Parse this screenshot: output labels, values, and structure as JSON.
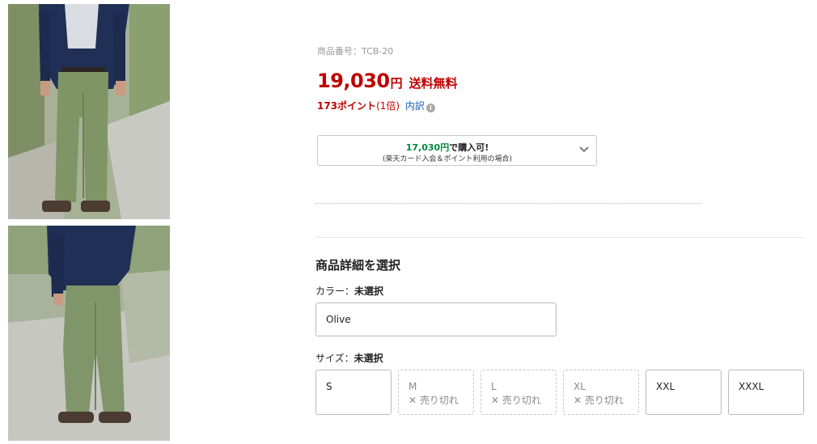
{
  "photos": [
    {
      "name": "product-photo-front"
    },
    {
      "name": "product-photo-side"
    }
  ],
  "product": {
    "id_label": "商品番号：",
    "id_value": "TCB-20",
    "price": "19,030",
    "price_unit": "円",
    "shipping": "送料無料",
    "points": "173ポイント",
    "points_multiplier": "(1倍)",
    "breakdown_link": "内訳",
    "info_icon": "i"
  },
  "card_offer": {
    "price": "17,030円",
    "suffix": "で購入可!",
    "note": "(楽天カード入会＆ポイント利用の場合)"
  },
  "options": {
    "section_title": "商品詳細を選択",
    "color": {
      "label": "カラー：",
      "status": "未選択",
      "selected_value": "Olive"
    },
    "size": {
      "label": "サイズ：",
      "status": "未選択",
      "choices": [
        {
          "name": "S",
          "sold_out_text": ""
        },
        {
          "name": "M",
          "sold_out_text": "✕ 売り切れ"
        },
        {
          "name": "L",
          "sold_out_text": "✕ 売り切れ"
        },
        {
          "name": "XL",
          "sold_out_text": "✕ 売り切れ"
        },
        {
          "name": "XXL",
          "sold_out_text": ""
        },
        {
          "name": "XXXL",
          "sold_out_text": ""
        }
      ]
    }
  },
  "colors": {
    "price_red": "#bf0000",
    "link_blue": "#1a5fb4",
    "offer_green": "#00893d"
  },
  "icons": {
    "chevron": "chevron-down-icon",
    "info": "info-icon"
  }
}
